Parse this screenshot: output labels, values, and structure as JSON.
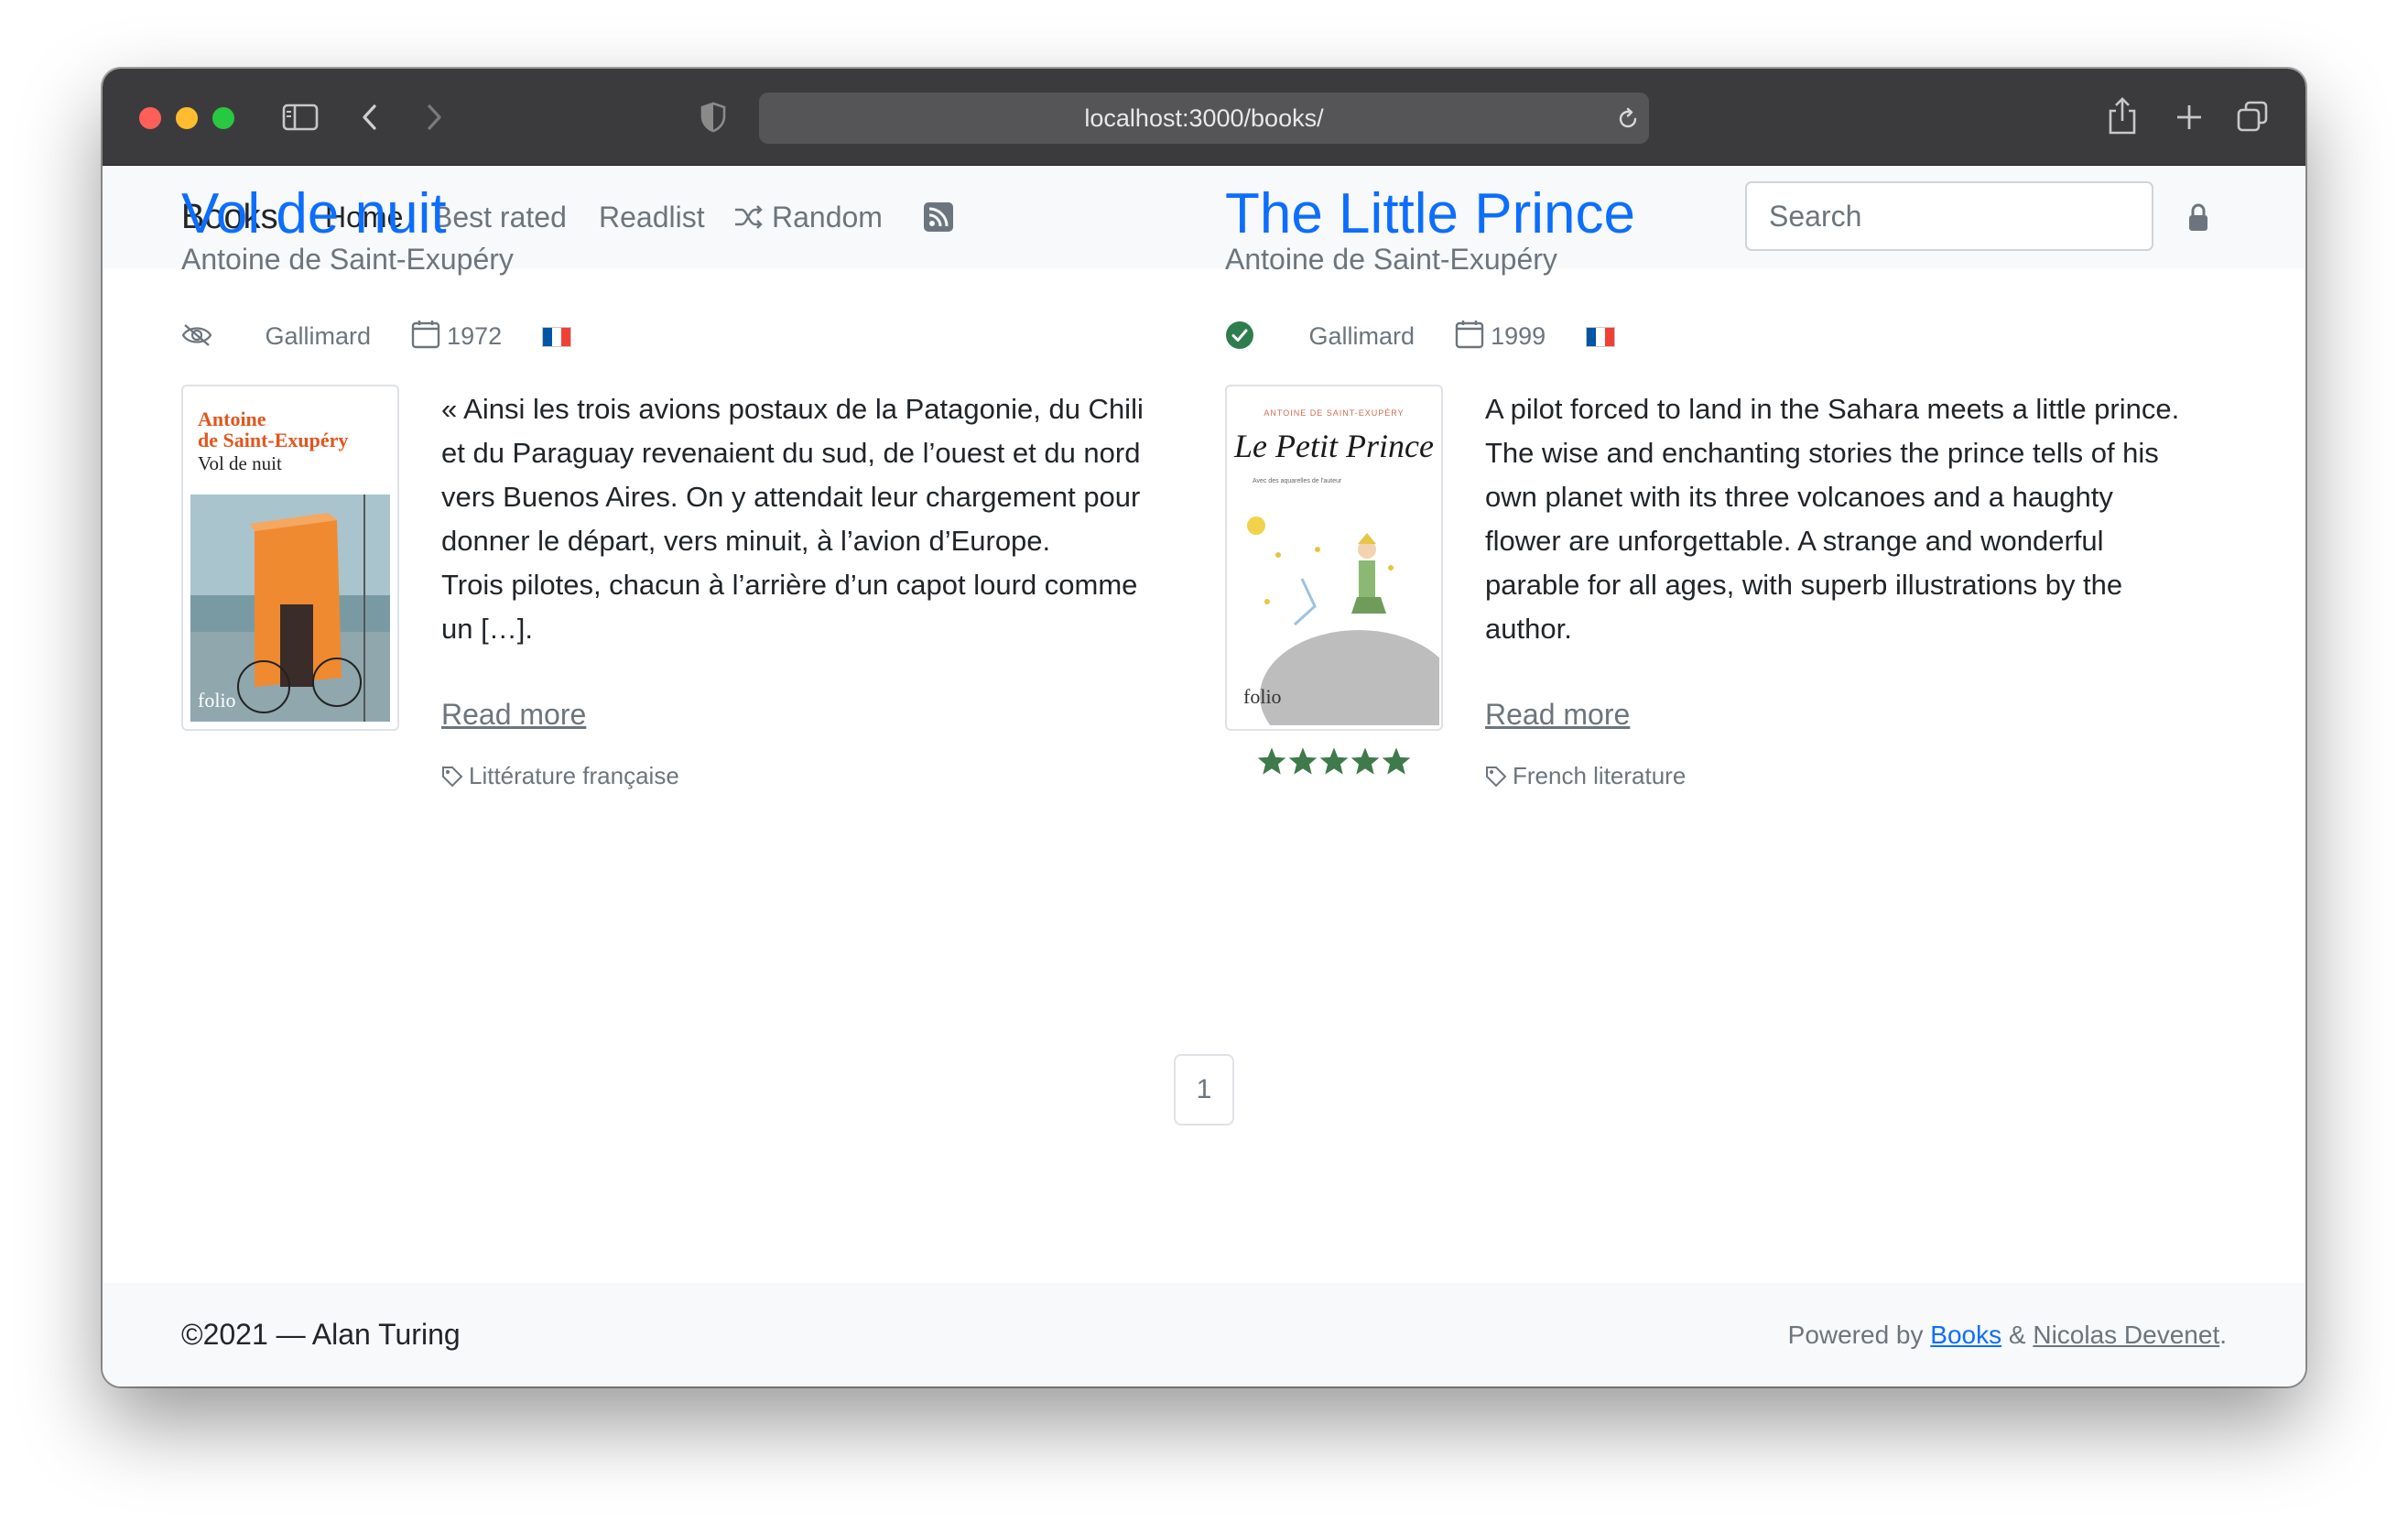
{
  "browser": {
    "url": "localhost:3000/books/"
  },
  "navbar": {
    "brand": "Books",
    "links": [
      {
        "label": "Home",
        "active": true
      },
      {
        "label": "Best rated",
        "active": false
      },
      {
        "label": "Readlist",
        "active": false
      },
      {
        "label": "Random",
        "active": false,
        "icon": "shuffle-icon"
      }
    ],
    "rss_icon": "rss-icon",
    "search_placeholder": "Search",
    "lock_icon": "lock-icon"
  },
  "books": [
    {
      "title": "Vol de nuit",
      "author": "Antoine de Saint-Exupéry",
      "status_icon": "eye-slash-icon",
      "publisher": "Gallimard",
      "year": "1972",
      "language_flag": "flag-fr-icon",
      "cover": {
        "author_line1": "Antoine",
        "author_line2": "de Saint-Exupéry",
        "title": "Vol de nuit",
        "publisher_mark": "folio"
      },
      "description_lines": [
        "« Ainsi les trois avions postaux de la Patagonie, du Chili",
        "et du Paraguay revenaient du sud, de l’ouest et du nord",
        "vers Buenos Aires. On y attendait leur chargement pour",
        "donner le départ, vers minuit, à l’avion d’Europe.",
        "Trois pilotes, chacun à l’arrière d’un capot lourd comme",
        "un […]."
      ],
      "read_more": "Read more",
      "tag": "Littérature française",
      "rating": null
    },
    {
      "title": "The Little Prince",
      "author": "Antoine de Saint-Exupéry",
      "status_icon": "check-circle-icon",
      "publisher": "Gallimard",
      "year": "1999",
      "language_flag": "flag-fr-icon",
      "cover": {
        "top_text": "ANTOINE DE SAINT-EXUPÉRY",
        "title": "Le Petit Prince",
        "subtitle": "Avec des aquarelles de l'auteur",
        "publisher_mark": "folio"
      },
      "description_lines": [
        "A pilot forced to land in the Sahara meets a little prince.",
        "The wise and enchanting stories the prince tells of his",
        "own planet with its three volcanoes and a haughty",
        "flower are unforgettable. A strange and wonderful",
        "parable for all ages, with superb illustrations by the",
        "author."
      ],
      "read_more": "Read more",
      "tag": "French literature",
      "rating": 5
    }
  ],
  "pagination": {
    "current": "1"
  },
  "footer": {
    "copyright": "©2021 — Alan Turing",
    "powered_prefix": "Powered by ",
    "powered_link1": "Books",
    "powered_amp": " & ",
    "powered_link2": "Nicolas Devenet",
    "powered_suffix": "."
  },
  "colors": {
    "link": "#0d6efd",
    "muted": "#6c757d",
    "success": "#2e7d4f",
    "star": "#3f7a4a"
  }
}
